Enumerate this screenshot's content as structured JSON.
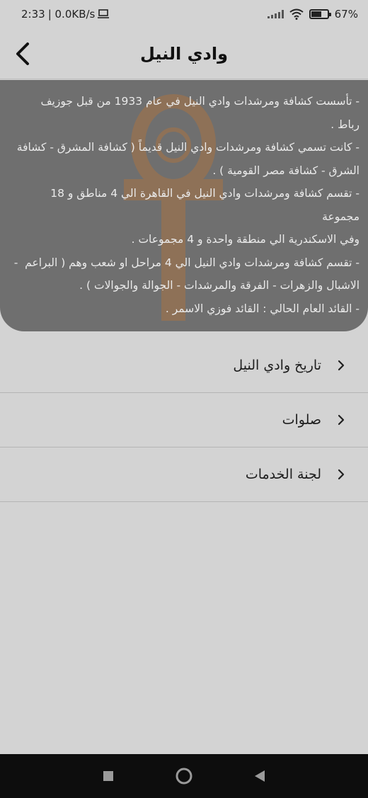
{
  "status_bar": {
    "time": "2:33",
    "net_speed": "| 0.0KB/s",
    "battery_percent": "67",
    "battery_suffix": "%",
    "battery_level": 0.67
  },
  "header": {
    "title": "وادي النيل"
  },
  "info": {
    "lines": [
      "- تأسست كشافة ومرشدات وادي النيل في عام 1933 من قبل جوزيف",
      "رباط .",
      "- كانت تسمي كشافة ومرشدات وادي النيل قديماً ( كشافة المشرق - كشافة",
      "الشرق - كشافة مصر القومية ) .",
      "- تقسم كشافة ومرشدات وادي النيل في القاهرة الي 4 مناطق و 18 مجموعة",
      "وفي الاسكندرية الي منطقة واحدة و 4 مجموعات .",
      "- تقسم كشافة ومرشدات وادي النيل الي 4 مراحل او شعب وهم ( البراعم  -",
      "الاشبال والزهرات - الفرقة والمرشدات - الجوالة والجوالات ) .",
      "- القائد العام الحالي : القائد فوزي الاسمر ."
    ]
  },
  "menu": {
    "items": [
      {
        "label": "تاريخ وادي النيل"
      },
      {
        "label": "صلوات"
      },
      {
        "label": "لجنة الخدمات"
      }
    ]
  },
  "colors": {
    "background": "#d3d3d3",
    "card": "#6f6f6f",
    "watermark": "#c9762b",
    "nav_bar": "#0d0d0d"
  },
  "icons": {
    "back": "chevron-left-icon",
    "menu_chevron": "chevron-right-icon",
    "watermark": "ankh-logo",
    "nav_recent": "square-icon",
    "nav_home": "circle-icon",
    "nav_back": "triangle-icon"
  }
}
